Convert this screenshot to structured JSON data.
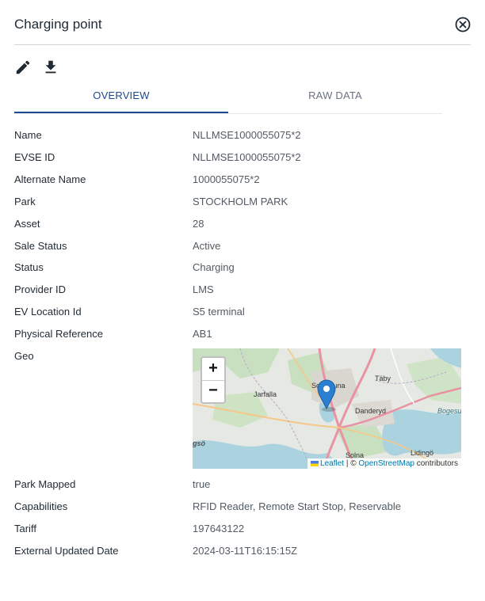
{
  "dialog": {
    "title": "Charging point"
  },
  "tabs": [
    {
      "label": "OVERVIEW",
      "active": true
    },
    {
      "label": "RAW DATA",
      "active": false
    }
  ],
  "fields": [
    {
      "label": "Name",
      "value": "NLLMSE1000055075*2"
    },
    {
      "label": "EVSE ID",
      "value": "NLLMSE1000055075*2"
    },
    {
      "label": "Alternate Name",
      "value": "1000055075*2"
    },
    {
      "label": "Park",
      "value": "STOCKHOLM PARK"
    },
    {
      "label": "Asset",
      "value": "28"
    },
    {
      "label": "Sale Status",
      "value": "Active"
    },
    {
      "label": "Status",
      "value": "Charging"
    },
    {
      "label": "Provider ID",
      "value": "LMS"
    },
    {
      "label": "EV Location Id",
      "value": "S5 terminal"
    },
    {
      "label": "Physical Reference",
      "value": "AB1"
    },
    {
      "label": "Geo",
      "value": ""
    },
    {
      "label": "Park Mapped",
      "value": "true"
    },
    {
      "label": "Capabilities",
      "value": "RFID Reader, Remote Start Stop, Reservable"
    },
    {
      "label": "Tariff",
      "value": "197643122"
    },
    {
      "label": "External Updated Date",
      "value": "2024-03-11T16:15:15Z"
    }
  ],
  "map": {
    "zoom_in": "+",
    "zoom_out": "−",
    "attribution_leaflet": "Leaflet",
    "attribution_sep": " | © ",
    "attribution_osm": "OpenStreetMap",
    "attribution_tail": " contributors",
    "place_labels": [
      "Jarfalla",
      "Sollentuna",
      "Täby",
      "Danderyd",
      "Bogesu",
      "Lidingö",
      "Solna",
      "gsö"
    ],
    "marker_color": "#2a7fd0"
  },
  "icons": {
    "edit": "pencil-icon",
    "download": "download-icon",
    "close": "close-circle-icon"
  },
  "colors": {
    "accent": "#1c4a8c",
    "label": "#1f2933",
    "value": "#525a63"
  }
}
